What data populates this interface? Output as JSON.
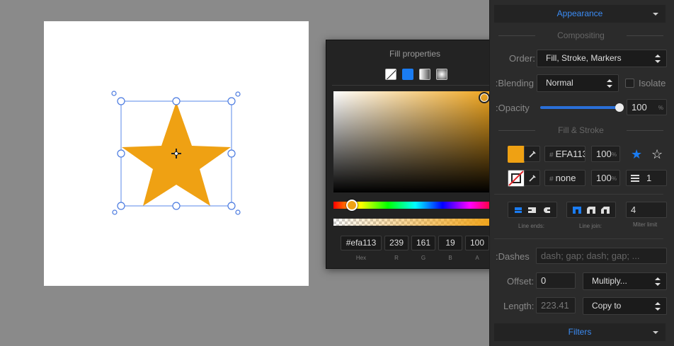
{
  "colors": {
    "fill": "#efa113",
    "accent": "#1a7cf2",
    "panel_bg": "#2b2b2b"
  },
  "canvas": {
    "shape_icon": "star-shape"
  },
  "fill_popup": {
    "title": "Fill properties",
    "fill_types": [
      "none",
      "solid",
      "linear-gradient",
      "radial-gradient"
    ],
    "fields": [
      {
        "value": "#efa113",
        "label": "Hex"
      },
      {
        "value": "239",
        "label": "R"
      },
      {
        "value": "161",
        "label": "G"
      },
      {
        "value": "19",
        "label": "B"
      },
      {
        "value": "100",
        "label": "A"
      }
    ],
    "hue": 0.08,
    "alpha": 1.0
  },
  "panel": {
    "appearance_header": "Appearance",
    "compositing_title": "Compositing",
    "order_label": "Order:",
    "order_value": "Fill, Stroke, Markers",
    "blending_label": "Blending:",
    "blending_value": "Normal",
    "isolate_label": "Isolate",
    "opacity_label": "Opacity:",
    "opacity_value": "100",
    "opacity_unit": "%",
    "opacity_level": 1.0,
    "fill_stroke_title": "Fill & Stroke",
    "fill_hex": "EFA113",
    "fill_opacity": "100",
    "stroke_hex": "none",
    "stroke_opacity": "100",
    "stroke_width": "1",
    "pct": "%",
    "hash": "#",
    "line_ends_label": "Line ends:",
    "line_join_label": "Line join:",
    "miter_limit_label": "Miter limit",
    "miter_limit_value": "4",
    "dashes_label": "Dashes:",
    "dashes_placeholder": "dash; gap; dash; gap; ...",
    "offset_label": "Offset:",
    "offset_value": "0",
    "offset_mode": "Multiply...",
    "length_label": "Length:",
    "length_value": "223.41",
    "length_mode": "Copy to",
    "filters_header": "Filters"
  }
}
